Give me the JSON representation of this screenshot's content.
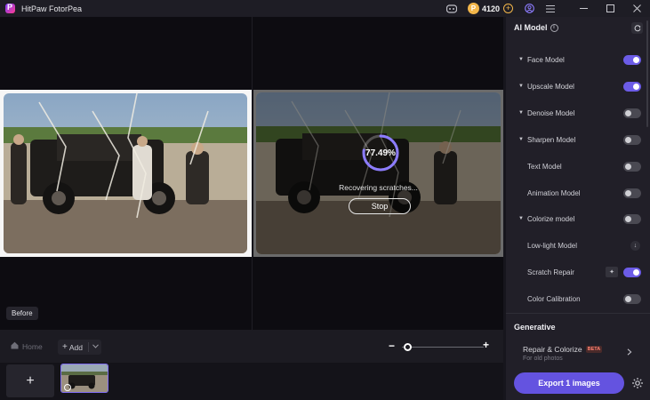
{
  "app": {
    "title": "HitPaw FotorPea"
  },
  "titlebar": {
    "coins": "4120"
  },
  "canvas": {
    "progress_text": "77.49%",
    "progress_value": 0.7749,
    "status": "Recovering scratches...",
    "stop_label": "Stop",
    "before_label": "Before"
  },
  "toolbar": {
    "home_label": "Home",
    "add_label": "Add"
  },
  "panel": {
    "section_title": "AI Model",
    "models": [
      {
        "label": "Face Model",
        "on": true,
        "expandable": true
      },
      {
        "label": "Upscale Model",
        "on": true,
        "expandable": true
      },
      {
        "label": "Denoise Model",
        "on": false,
        "expandable": true
      },
      {
        "label": "Sharpen Model",
        "on": false,
        "expandable": true
      },
      {
        "label": "Text Model",
        "on": false,
        "expandable": false
      },
      {
        "label": "Animation Model",
        "on": false,
        "expandable": false
      },
      {
        "label": "Colorize model",
        "on": false,
        "expandable": true
      },
      {
        "label": "Low-light Model",
        "on": false,
        "expandable": false
      },
      {
        "label": "Scratch Repair",
        "on": true,
        "expandable": false
      },
      {
        "label": "Color Calibration",
        "on": false,
        "expandable": false
      }
    ],
    "generative_title": "Generative",
    "generative_item": {
      "label": "Repair & Colorize",
      "badge": "BETA",
      "sub": "For old photos"
    },
    "export_label": "Export 1 images"
  },
  "colors": {
    "accent": "#6c5ce7",
    "coin": "#f2b64a"
  }
}
